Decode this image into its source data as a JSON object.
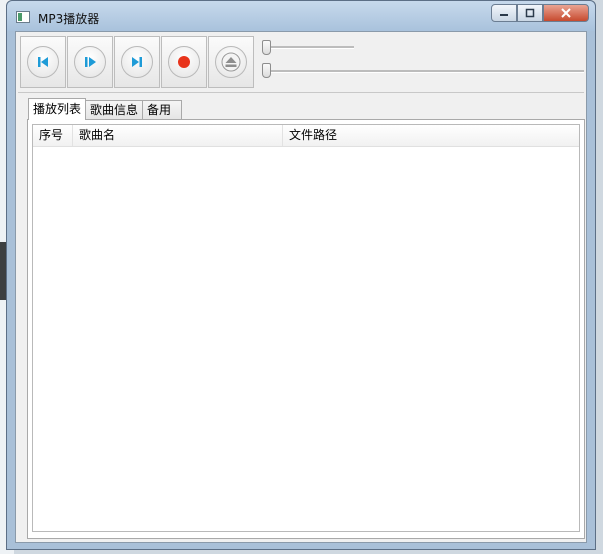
{
  "window": {
    "title": "MP3播放器"
  },
  "window_controls": {
    "minimize": "▭",
    "maximize": "□",
    "close": "✕"
  },
  "toolbar": {
    "buttons": [
      {
        "name": "previous",
        "icon": "skip-previous-icon"
      },
      {
        "name": "play",
        "icon": "play-icon"
      },
      {
        "name": "next",
        "icon": "skip-next-icon"
      },
      {
        "name": "stop",
        "icon": "record-stop-icon"
      },
      {
        "name": "eject",
        "icon": "eject-icon"
      }
    ],
    "volume_slider": {
      "value": 0
    },
    "progress_slider": {
      "value": 0
    }
  },
  "tabs": [
    {
      "label": "播放列表",
      "active": true
    },
    {
      "label": "歌曲信息",
      "active": false
    },
    {
      "label": "备用",
      "active": false
    }
  ],
  "playlist": {
    "columns": [
      "序号",
      "歌曲名",
      "文件路径"
    ],
    "rows": []
  },
  "colors": {
    "accent_blue": "#1e9bd7",
    "stop_red": "#e8341c"
  }
}
